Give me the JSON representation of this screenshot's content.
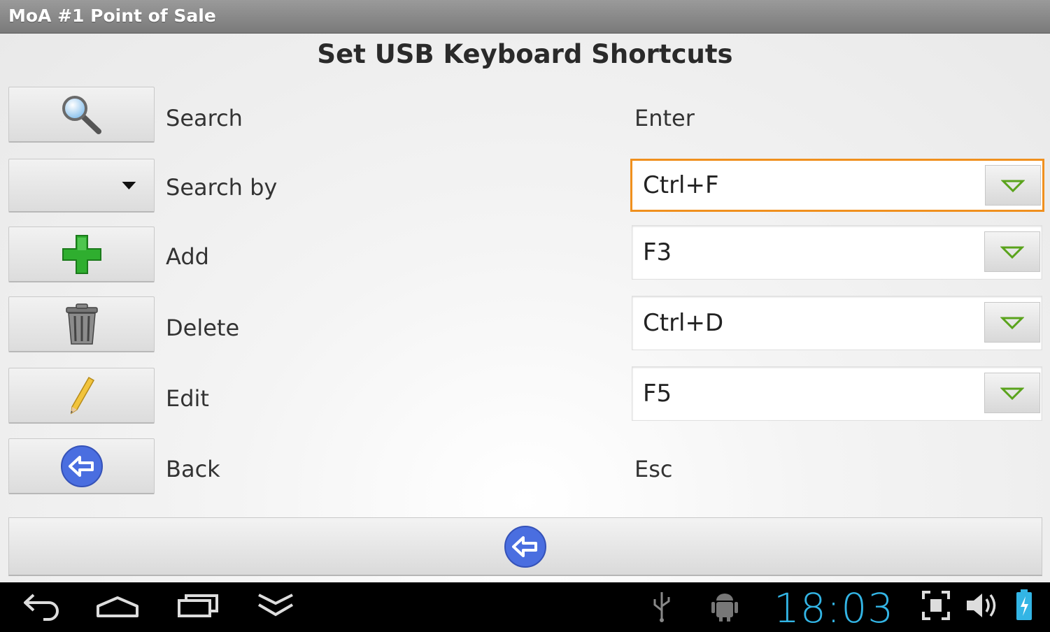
{
  "window": {
    "title": "MoA #1 Point of Sale"
  },
  "page": {
    "heading": "Set USB Keyboard Shortcuts"
  },
  "rows": [
    {
      "label": "Search",
      "icon": "search-icon",
      "key": "Enter"
    },
    {
      "label": "Search by",
      "icon": "dropdown-arrow-icon",
      "key": "Ctrl+F"
    },
    {
      "label": "Add",
      "icon": "add-icon",
      "key": "F3"
    },
    {
      "label": "Delete",
      "icon": "trash-icon",
      "key": "Ctrl+D"
    },
    {
      "label": "Edit",
      "icon": "pencil-icon",
      "key": "F5"
    },
    {
      "label": "Back",
      "icon": "back-arrow-icon",
      "key": "Esc"
    }
  ],
  "bottom_button": {
    "icon": "back-arrow-icon"
  },
  "system_bar": {
    "time": "18:03",
    "icons": [
      "back-icon",
      "home-icon",
      "recent-apps-icon",
      "menu-icon",
      "usb-icon",
      "android-debug-icon",
      "screenshot-icon",
      "volume-icon",
      "battery-icon"
    ]
  },
  "colors": {
    "focus": "#f0901e",
    "accent": "#33b5e5",
    "add_green": "#2fae2f",
    "back_blue": "#4a6ee0"
  }
}
